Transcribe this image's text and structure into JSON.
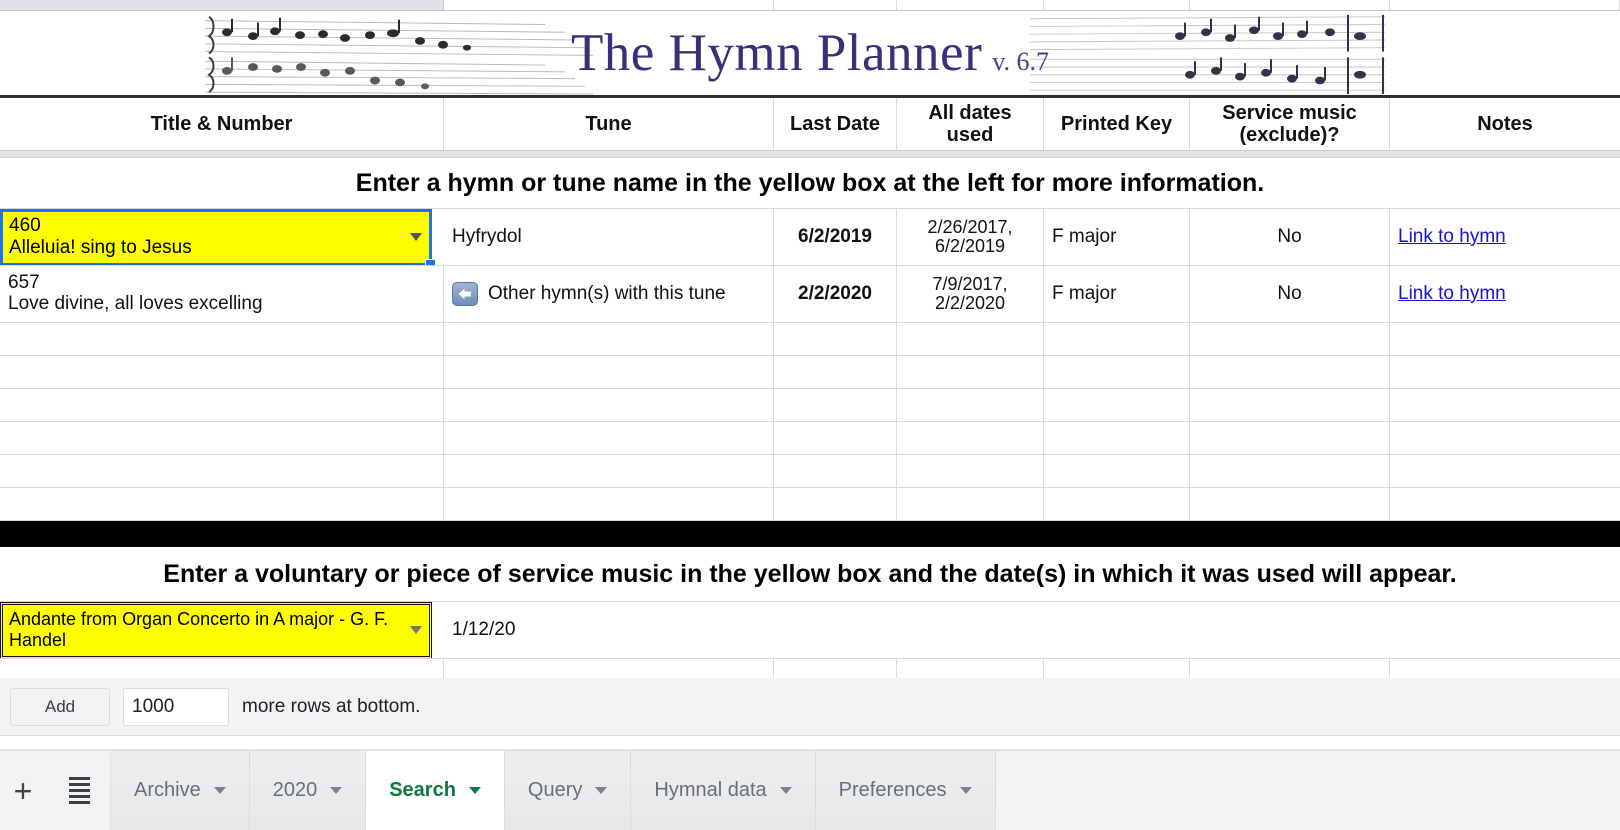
{
  "banner": {
    "title": "The Hymn Planner",
    "version": "v. 6.7",
    "title_color": "#3b2f7a"
  },
  "column_headers": [
    "Title & Number",
    "Tune",
    "Last Date",
    "All dates used",
    "Printed Key",
    "Service music\n(exclude)?",
    "Notes"
  ],
  "hymn_section": {
    "instruction": "Enter a hymn or tune name in the yellow box at the left for more information.",
    "rows": [
      {
        "title_number": "460\nAlleluia! sing to Jesus",
        "is_yellow_input": true,
        "selected": true,
        "tune": "Hyfrydol",
        "tune_icon": null,
        "last_date": "6/2/2019",
        "all_dates_used": "2/26/2017,\n6/2/2019",
        "printed_key": "F major",
        "service_music": "No",
        "notes": "Link to hymn"
      },
      {
        "title_number": "657\nLove divine, all loves excelling",
        "is_yellow_input": false,
        "selected": false,
        "tune": "Other hymn(s) with this tune",
        "tune_icon": "back-arrow-icon",
        "last_date": "2/2/2020",
        "all_dates_used": "7/9/2017,\n2/2/2020",
        "printed_key": "F major",
        "service_music": "No",
        "notes": "Link to hymn"
      }
    ],
    "empty_row_count": 6
  },
  "voluntary_section": {
    "instruction": "Enter a voluntary or piece of service music in the yellow box and the date(s) in which it was used will appear.",
    "entry": {
      "piece": "Andante from Organ Concerto in A major - G. F. Handel",
      "dates": "1/12/20"
    }
  },
  "add_rows_bar": {
    "button_label": "Add",
    "count_value": "1000",
    "trailing_text": "more rows at bottom."
  },
  "sheet_tabs": {
    "add_sheet_icon": "plus-icon",
    "all_sheets_icon": "hamburger-icon",
    "tabs": [
      {
        "label": "Archive",
        "active": false
      },
      {
        "label": "2020",
        "active": false
      },
      {
        "label": "Search",
        "active": true
      },
      {
        "label": "Query",
        "active": false
      },
      {
        "label": "Hymnal data",
        "active": false
      },
      {
        "label": "Preferences",
        "active": false
      }
    ],
    "active_tab_color": "#0c7a3d"
  }
}
